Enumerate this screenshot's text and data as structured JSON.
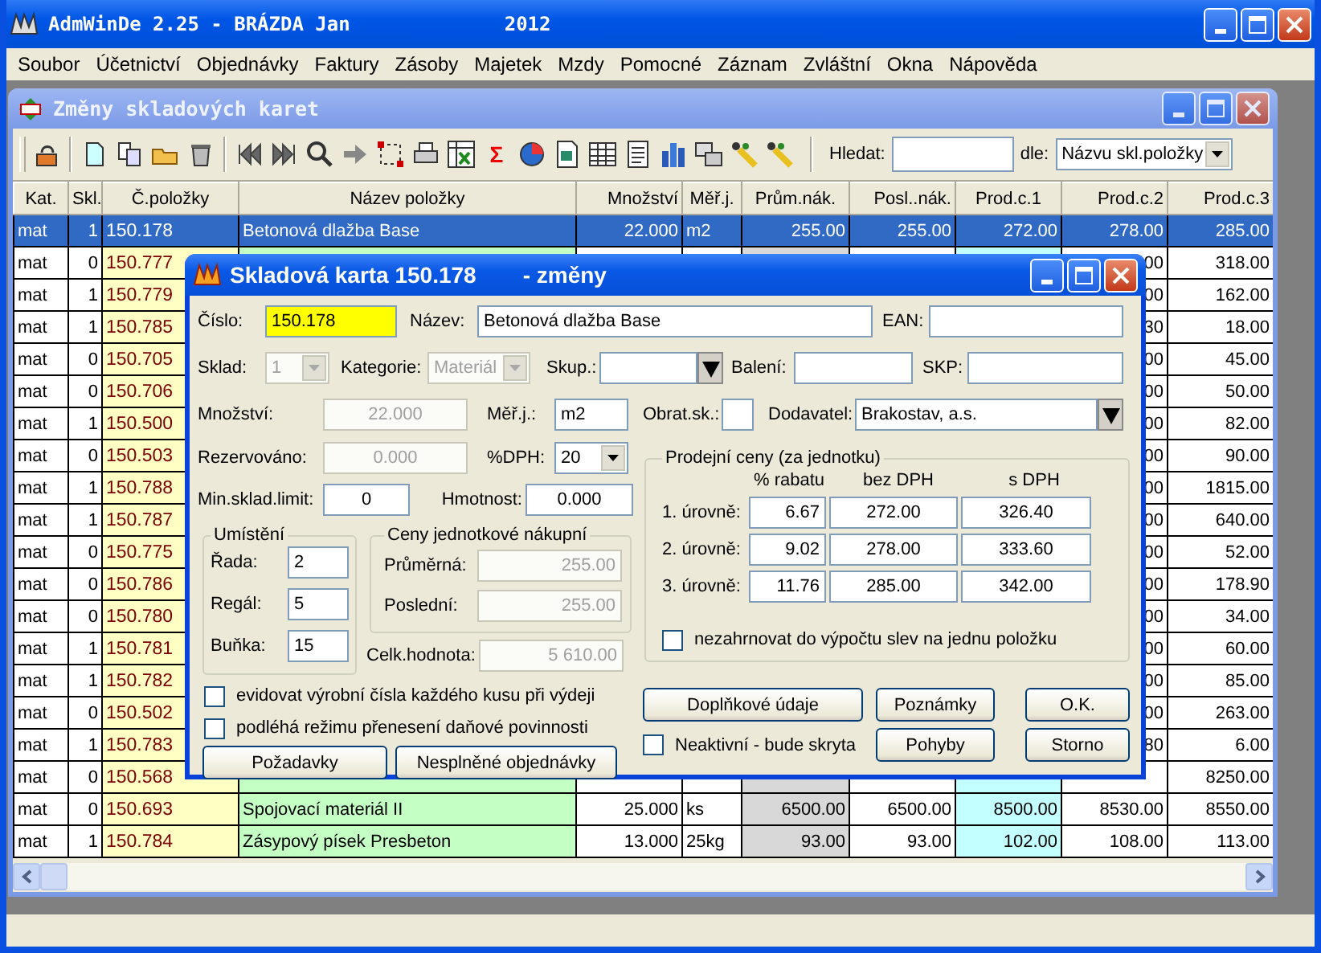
{
  "window": {
    "title": "AdmWinDe 2.25 - BRÁZDA Jan",
    "year": "2012"
  },
  "menu": [
    "Soubor",
    "Účetnictví",
    "Objednávky",
    "Faktury",
    "Zásoby",
    "Majetek",
    "Mzdy",
    "Pomocné",
    "Záznam",
    "Zvláštní",
    "Okna",
    "Nápověda"
  ],
  "child_window": {
    "title": "Změny skladových karet",
    "sum_glyph": "Σ"
  },
  "search": {
    "label": "Hledat:",
    "by_label": "dle:",
    "by_value": "Názvu skl.položky"
  },
  "table": {
    "columns": [
      "Kat.",
      "Skl.",
      "Č.položky",
      "Název položky",
      "Množství",
      "Měř.j.",
      "Prům.nák.",
      "Posl..nák.",
      "Prod.c.1",
      "Prod.c.2",
      "Prod.c.3"
    ],
    "rows": [
      {
        "selected": true,
        "kat": "mat",
        "skl": "1",
        "cislo": "150.178",
        "nazev": "Betonová dlažba Base",
        "mnozstvi": "22.000",
        "merj": "m2",
        "prum": "255.00",
        "posl": "255.00",
        "prod1": "272.00",
        "prod2": "278.00",
        "prod3": "285.00"
      },
      {
        "selected": false,
        "kat": "mat",
        "skl": "0",
        "cislo": "150.777",
        "prod2": "00",
        "prod3": "318.00"
      },
      {
        "selected": false,
        "kat": "mat",
        "skl": "1",
        "cislo": "150.779",
        "prod2": "00",
        "prod3": "162.00"
      },
      {
        "selected": false,
        "kat": "mat",
        "skl": "1",
        "cislo": "150.785",
        "prod2": "30",
        "prod3": "18.00"
      },
      {
        "selected": false,
        "kat": "mat",
        "skl": "0",
        "cislo": "150.705",
        "prod2": "00",
        "prod3": "45.00"
      },
      {
        "selected": false,
        "kat": "mat",
        "skl": "0",
        "cislo": "150.706",
        "prod2": "00",
        "prod3": "50.00"
      },
      {
        "selected": false,
        "kat": "mat",
        "skl": "1",
        "cislo": "150.500",
        "prod2": "00",
        "prod3": "82.00"
      },
      {
        "selected": false,
        "kat": "mat",
        "skl": "0",
        "cislo": "150.503",
        "prod2": "00",
        "prod3": "90.00"
      },
      {
        "selected": false,
        "kat": "mat",
        "skl": "1",
        "cislo": "150.788",
        "prod2": "00",
        "prod3": "1815.00"
      },
      {
        "selected": false,
        "kat": "mat",
        "skl": "1",
        "cislo": "150.787",
        "prod2": "00",
        "prod3": "640.00"
      },
      {
        "selected": false,
        "kat": "mat",
        "skl": "0",
        "cislo": "150.775",
        "prod2": "00",
        "prod3": "52.00"
      },
      {
        "selected": false,
        "kat": "mat",
        "skl": "0",
        "cislo": "150.786",
        "prod2": "00",
        "prod3": "178.90"
      },
      {
        "selected": false,
        "kat": "mat",
        "skl": "0",
        "cislo": "150.780",
        "prod2": "00",
        "prod3": "34.00"
      },
      {
        "selected": false,
        "kat": "mat",
        "skl": "1",
        "cislo": "150.781",
        "prod2": "00",
        "prod3": "60.00"
      },
      {
        "selected": false,
        "kat": "mat",
        "skl": "1",
        "cislo": "150.782",
        "prod2": "00",
        "prod3": "85.00"
      },
      {
        "selected": false,
        "kat": "mat",
        "skl": "0",
        "cislo": "150.502",
        "prod2": "00",
        "prod3": "263.00"
      },
      {
        "selected": false,
        "kat": "mat",
        "skl": "1",
        "cislo": "150.783",
        "prod2": "80",
        "prod3": "6.00"
      },
      {
        "selected": false,
        "kat": "mat",
        "skl": "0",
        "cislo": "150.568",
        "prod3": "8250.00"
      },
      {
        "selected": false,
        "kat": "mat",
        "skl": "0",
        "cislo": "150.693",
        "nazev": "Spojovací materiál II",
        "mnozstvi": "25.000",
        "merj": "ks",
        "prum": "6500.00",
        "posl": "6500.00",
        "prod1": "8500.00",
        "prod2": "8530.00",
        "prod3": "8550.00"
      },
      {
        "selected": false,
        "kat": "mat",
        "skl": "1",
        "cislo": "150.784",
        "nazev": "Zásypový písek Presbeton",
        "mnozstvi": "13.000",
        "merj": "25kg",
        "prum": "93.00",
        "posl": "93.00",
        "prod1": "102.00",
        "prod2": "108.00",
        "prod3": "113.00"
      }
    ]
  },
  "dialog": {
    "title": "Skladová karta 150.178",
    "mode": "- změny",
    "cislo": {
      "label": "Číslo:",
      "value": "150.178"
    },
    "nazev": {
      "label": "Název:",
      "value": "Betonová dlažba Base"
    },
    "ean": {
      "label": "EAN:"
    },
    "sklad": {
      "label": "Sklad:",
      "value": "1",
      "disabled": true
    },
    "kategorie": {
      "label": "Kategorie:",
      "value": "Materiál",
      "disabled": true
    },
    "skup": {
      "label": "Skup.:"
    },
    "baleni": {
      "label": "Balení:"
    },
    "skp": {
      "label": "SKP:"
    },
    "mnozstvi": {
      "label": "Množství:",
      "value": "22.000",
      "disabled": true
    },
    "merj": {
      "label": "Měř.j.:",
      "value": "m2"
    },
    "obrat": {
      "label": "Obrat.sk.:"
    },
    "dodavatel": {
      "label": "Dodavatel:",
      "value": "Brakostav, a.s."
    },
    "rezervovano": {
      "label": "Rezervováno:",
      "value": "0.000",
      "disabled": true
    },
    "dph": {
      "label": "%DPH:",
      "value": "20"
    },
    "min_limit": {
      "label": "Min.sklad.limit:",
      "value": "0"
    },
    "hmotnost": {
      "label": "Hmotnost:",
      "value": "0.000"
    },
    "umisteni": {
      "title": "Umístění",
      "fields": [
        {
          "label": "Řada:",
          "value": "2"
        },
        {
          "label": "Regál:",
          "value": "5"
        },
        {
          "label": "Buňka:",
          "value": "15"
        }
      ]
    },
    "ceny_nakupni": {
      "title": "Ceny jednotkové nákupní",
      "fields": [
        {
          "label": "Průměrná:",
          "value": "255.00",
          "disabled": true
        },
        {
          "label": "Poslední:",
          "value": "255.00",
          "disabled": true
        }
      ]
    },
    "celk_hodnota": {
      "label": "Celk.hodnota:",
      "value": "5 610.00",
      "disabled": true
    },
    "prodejni": {
      "title": "Prodejní ceny (za jednotku)",
      "columns": [
        "% rabatu",
        "bez DPH",
        "s DPH"
      ],
      "rows": [
        {
          "label": "1. úrovně:",
          "values": [
            "6.67",
            "272.00",
            "326.40"
          ]
        },
        {
          "label": "2. úrovně:",
          "values": [
            "9.02",
            "278.00",
            "333.60"
          ]
        },
        {
          "label": "3. úrovně:",
          "values": [
            "11.76",
            "285.00",
            "342.00"
          ]
        }
      ],
      "checkbox": {
        "label": "nezahrnovat do výpočtu slev na jednu položku",
        "checked": false
      }
    },
    "checkboxes": [
      {
        "label": "evidovat výrobní čísla každého kusu při výdeji",
        "checked": false
      },
      {
        "label": "podléhá režimu přenesení daňové povinnosti",
        "checked": false
      }
    ],
    "left_buttons": [
      "Požadavky",
      "Nesplněné objednávky"
    ],
    "doplnkove": "Doplňkové údaje",
    "poznamky": "Poznámky",
    "ok": "O.K.",
    "neaktivni": {
      "label": "Neaktivní - bude skryta",
      "checked": false
    },
    "pohyby": "Pohyby",
    "storno": "Storno"
  }
}
